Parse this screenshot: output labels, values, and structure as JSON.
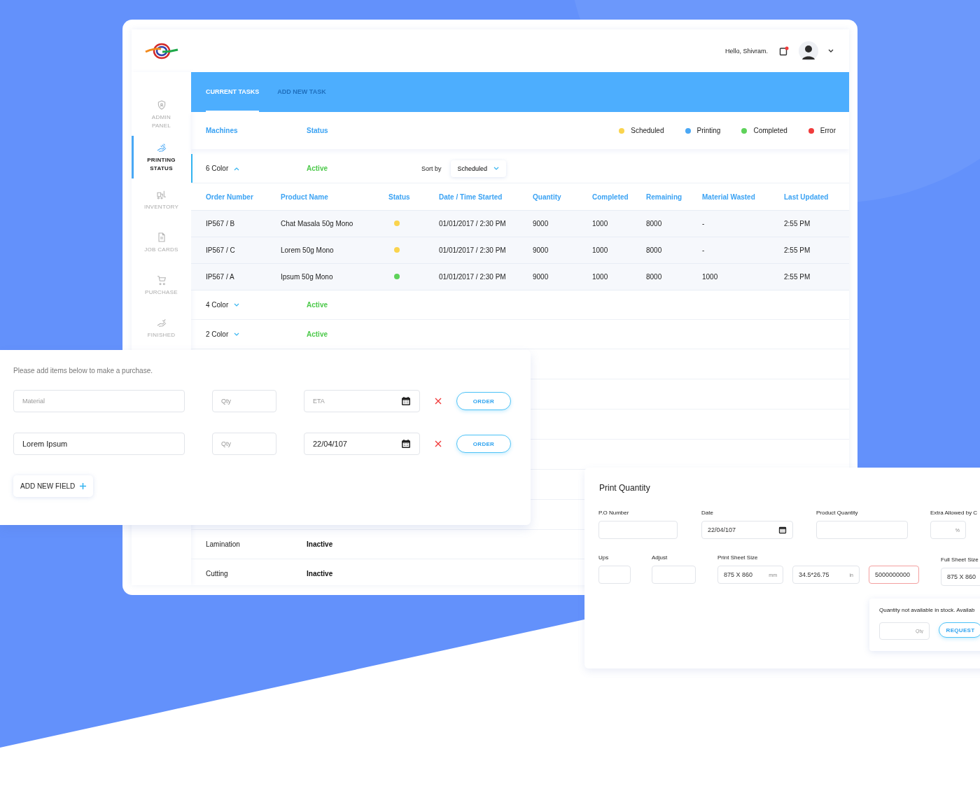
{
  "header": {
    "greeting": "Hello, Shivram."
  },
  "sidebar": {
    "items": [
      {
        "label": "ADMIN PANEL",
        "selected": false
      },
      {
        "label": "PRINTING STATUS",
        "selected": true
      },
      {
        "label": "INVENTORY",
        "selected": false
      },
      {
        "label": "JOB CARDS",
        "selected": false
      },
      {
        "label": "PURCHASE",
        "selected": false
      },
      {
        "label": "FINISHED",
        "selected": false
      }
    ]
  },
  "tabs": [
    {
      "label": "CURRENT TASKS",
      "selected": true
    },
    {
      "label": "ADD NEW TASK",
      "selected": false
    }
  ],
  "filters": [
    "Machines",
    "Status"
  ],
  "legend": [
    {
      "label": "Scheduled",
      "color": "#fad44e"
    },
    {
      "label": "Printing",
      "color": "#4aa8f5"
    },
    {
      "label": "Completed",
      "color": "#5ed25a"
    },
    {
      "label": "Error",
      "color": "#f03b3b"
    }
  ],
  "machines": [
    {
      "name": "6 Color",
      "status": "Active",
      "active": true,
      "expanded": true,
      "sort": {
        "label": "Sort by",
        "value": "Scheduled"
      },
      "table": {
        "columns": [
          "Order Number",
          "Product Name",
          "Status",
          "Date / Time Started",
          "Quantity",
          "Completed",
          "Remaining",
          "Material Wasted",
          "Last Updated"
        ],
        "rows": [
          {
            "order_number": "IP567 / B",
            "product_name": "Chat Masala 50g Mono",
            "color": "#fad44e",
            "date_time_started": "01/01/2017 / 2:30 PM",
            "quantity": "9000",
            "completed": "1000",
            "remaining": "8000",
            "material_wasted": "-",
            "last_updated": "2:55 PM"
          },
          {
            "order_number": "IP567 / C",
            "product_name": "Lorem 50g Mono",
            "color": "#fad44e",
            "date_time_started": "01/01/2017 / 2:30 PM",
            "quantity": "9000",
            "completed": "1000",
            "remaining": "8000",
            "material_wasted": "-",
            "last_updated": "2:55 PM"
          },
          {
            "order_number": "IP567 / A",
            "product_name": "Ipsum 50g Mono",
            "color": "#5ed25a",
            "date_time_started": "01/01/2017 / 2:30 PM",
            "quantity": "9000",
            "completed": "1000",
            "remaining": "8000",
            "material_wasted": "1000",
            "last_updated": "2:55 PM"
          }
        ]
      }
    },
    {
      "name": "4 Color",
      "status": "Active",
      "active": true,
      "expanded": false
    },
    {
      "name": "2 Color",
      "status": "Active",
      "active": true,
      "expanded": false
    },
    {
      "name": "Lamination",
      "status": "Inactive",
      "active": false
    },
    {
      "name": "Cutting",
      "status": "Inactive",
      "active": false
    }
  ],
  "purchase": {
    "intro": "Please add items below to make a purchase.",
    "rows": [
      {
        "material": {
          "placeholder": "Material"
        },
        "qty": {
          "placeholder": "Qty"
        },
        "eta": {
          "placeholder": "ETA"
        },
        "button": "ORDER"
      },
      {
        "material": {
          "value": "Lorem Ipsum"
        },
        "qty": {
          "placeholder": "Qty"
        },
        "eta": {
          "value": "22/04/107"
        },
        "button": "ORDER"
      }
    ],
    "add_button": "ADD NEW FIELD"
  },
  "print_quantity": {
    "title": "Print Quantity",
    "po_number": {
      "label": "P.O Number"
    },
    "date": {
      "label": "Date",
      "value": "22/04/107"
    },
    "product_quantity": {
      "label": "Product Quantity"
    },
    "extra_allowed": {
      "label": "Extra Allowed by C",
      "unit": "%"
    },
    "ups": {
      "label": "Ups"
    },
    "adjust": {
      "label": "Adjust"
    },
    "print_sheet_size": {
      "label": "Print Sheet Size",
      "mm": {
        "value": "875 X 860",
        "unit": "mm"
      },
      "inches": {
        "value": "34.5*26.75",
        "unit": "in"
      },
      "sheets": {
        "value": "5000000000",
        "error": true
      }
    },
    "full_sheet_size": {
      "label": "Full Sheet Size",
      "value": "875 X 860"
    },
    "popover": {
      "message": "Quantity not available in stock. Availab",
      "qty": {
        "placeholder": "Qty"
      },
      "button": "REQUEST"
    }
  }
}
